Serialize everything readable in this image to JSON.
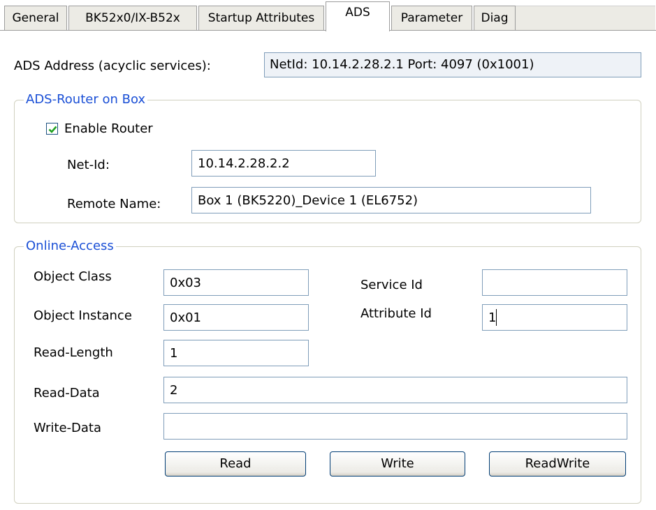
{
  "tabs": [
    {
      "label": "General"
    },
    {
      "label": "BK52x0/IX-B52x"
    },
    {
      "label": "Startup Attributes"
    },
    {
      "label": "ADS"
    },
    {
      "label": "Parameter"
    },
    {
      "label": "Diag"
    }
  ],
  "ads_address": {
    "label": "ADS Address (acyclic services):",
    "value": "NetId: 10.14.2.28.2.1    Port: 4097 (0x1001)"
  },
  "router_group": {
    "title": "ADS-Router on Box",
    "enable_router": {
      "label": "Enable Router",
      "checked": true
    },
    "net_id": {
      "label": "Net-Id:",
      "value": "10.14.2.28.2.2"
    },
    "remote_name": {
      "label": "Remote Name:",
      "value": "Box 1 (BK5220)_Device 1 (EL6752)"
    }
  },
  "online_group": {
    "title": "Online-Access",
    "object_class": {
      "label": "Object Class",
      "value": "0x03"
    },
    "object_instance": {
      "label": "Object Instance",
      "value": "0x01"
    },
    "read_length": {
      "label": "Read-Length",
      "value": "1"
    },
    "read_data": {
      "label": "Read-Data",
      "value": "2"
    },
    "write_data": {
      "label": "Write-Data",
      "value": ""
    },
    "service_id": {
      "label": "Service Id",
      "value": ""
    },
    "attribute_id": {
      "label": "Attribute Id",
      "value": "1"
    },
    "buttons": {
      "read": "Read",
      "write": "Write",
      "readwrite": "ReadWrite"
    }
  }
}
